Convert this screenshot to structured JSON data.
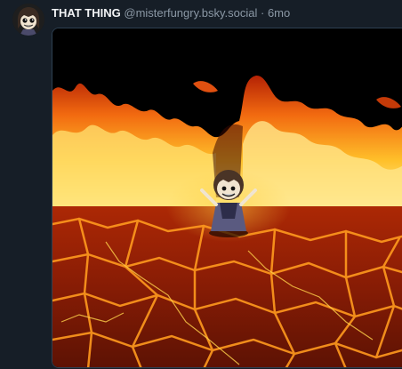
{
  "post": {
    "author_name": "THAT THING",
    "author_handle": "@misterfungry.bsky.social",
    "separator": "·",
    "timestamp": "6mo",
    "avatar_icon": "avatar-character-icon",
    "media_image": "pixel-art-character-standing-on-lava-field-with-fire"
  },
  "colors": {
    "background": "#161e27",
    "name": "#f1f3f5",
    "meta": "#8b98a5",
    "media_border": "#2e4052"
  }
}
